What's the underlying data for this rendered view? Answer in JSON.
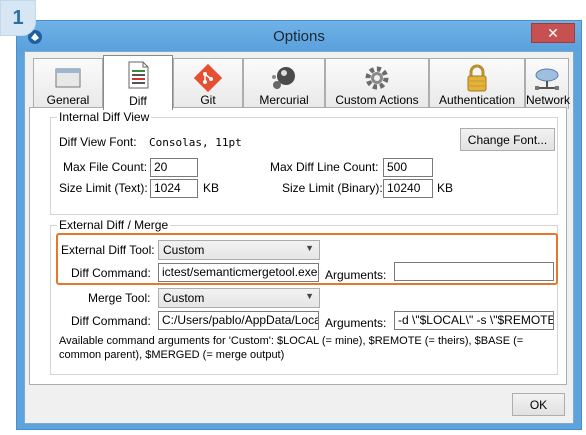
{
  "badge": "1",
  "window": {
    "title": "Options",
    "close_glyph": "✕"
  },
  "tabs": [
    {
      "label": "General",
      "icon": "general-icon"
    },
    {
      "label": "Diff",
      "icon": "diff-document-icon"
    },
    {
      "label": "Git",
      "icon": "git-icon"
    },
    {
      "label": "Mercurial",
      "icon": "mercurial-icon"
    },
    {
      "label": "Custom Actions",
      "icon": "gear-icon"
    },
    {
      "label": "Authentication",
      "icon": "padlock-icon"
    },
    {
      "label": "Network",
      "icon": "network-icon"
    }
  ],
  "active_tab": "Diff",
  "internal": {
    "legend": "Internal Diff View",
    "font_label": "Diff View Font:",
    "font_value": "Consolas, 11pt",
    "change_font": "Change Font...",
    "max_file_count_label": "Max File Count:",
    "max_file_count": "20",
    "max_line_count_label": "Max Diff Line Count:",
    "max_line_count": "500",
    "size_text_label": "Size Limit (Text):",
    "size_text": "1024",
    "size_binary_label": "Size Limit (Binary):",
    "size_binary": "10240",
    "kb": "KB"
  },
  "external": {
    "legend": "External Diff / Merge",
    "diff_tool_label": "External Diff Tool:",
    "diff_tool_value": "Custom",
    "diff_command_label": "Diff Command:",
    "diff_command_value": "ictest/semanticmergetool.exe",
    "arguments_label": "Arguments:",
    "diff_arguments_value": "",
    "merge_tool_label": "Merge Tool:",
    "merge_tool_value": "Custom",
    "merge_command_label": "Diff Command:",
    "merge_command_value": "C:/Users/pablo/AppData/Loca",
    "merge_arguments_value": "-d \\\"$LOCAL\\\" -s \\\"$REMOTE",
    "note": "Available command arguments for 'Custom': $LOCAL (= mine), $REMOTE (= theirs), $BASE (= common parent), $MERGED (= merge output)"
  },
  "ok_label": "OK",
  "colors": {
    "highlight": "#e5772a",
    "titlebar": "#5ea3dc",
    "close": "#c75050"
  }
}
